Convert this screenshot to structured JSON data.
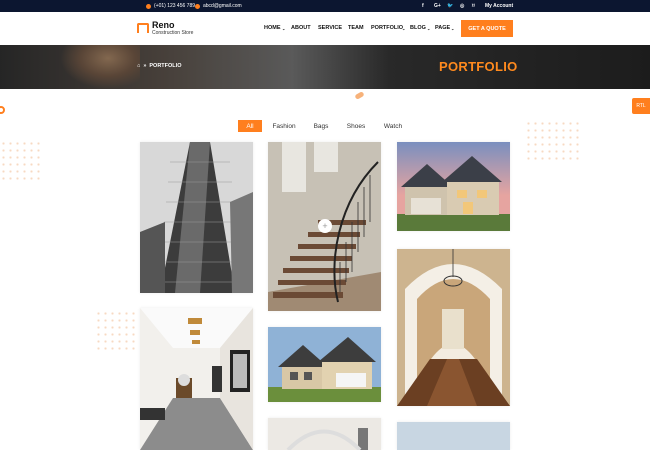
{
  "topbar": {
    "phone": "(+01) 123 456 789",
    "email": "abcd@gmail.com",
    "social": [
      "f",
      "G+",
      "🐦",
      "◎",
      "⌑"
    ],
    "account": "My Account"
  },
  "logo": {
    "name": "Reno",
    "tagline": "Construction Store"
  },
  "nav": {
    "items": [
      "HOME",
      "ABOUT",
      "SERVICE",
      "TEAM",
      "PORTFOLIO",
      "BLOG",
      "PAGE"
    ],
    "dropdown_flags": [
      true,
      false,
      false,
      false,
      true,
      true,
      true
    ],
    "cta": "GET A QUOTE"
  },
  "banner": {
    "breadcrumb_icon": "home-icon",
    "breadcrumb_sep": "»",
    "breadcrumb_current": "PORTFOLIO",
    "title": "PORTFOLIO"
  },
  "rtl_label": "RTL",
  "filters": {
    "items": [
      "All",
      "Fashion",
      "Bags",
      "Shoes",
      "Watch"
    ],
    "active": "All"
  },
  "portfolio": {
    "items": [
      {
        "name": "skyscraper"
      },
      {
        "name": "staircase"
      },
      {
        "name": "house-evening"
      },
      {
        "name": "hallway"
      },
      {
        "name": "house-day"
      },
      {
        "name": "chandelier-hall"
      },
      {
        "name": "room-top"
      },
      {
        "name": "sky-top"
      }
    ]
  },
  "colors": {
    "accent": "#ff7f1e",
    "topbar": "#0c1630"
  }
}
